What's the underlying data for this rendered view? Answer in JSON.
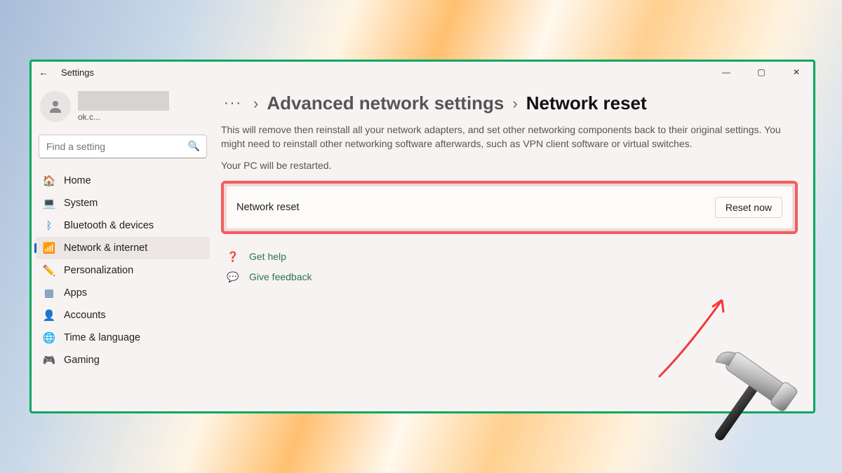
{
  "titlebar": {
    "app_name": "Settings",
    "back_glyph": "←",
    "min": "—",
    "max": "▢",
    "close": "✕"
  },
  "profile": {
    "email": "ok.c..."
  },
  "search": {
    "placeholder": "Find a setting"
  },
  "sidebar": {
    "items": [
      {
        "icon": "🏠",
        "label": "Home",
        "color": "#c97b3c"
      },
      {
        "icon": "💻",
        "label": "System",
        "color": "#1e88e5"
      },
      {
        "icon": "ᛒ",
        "label": "Bluetooth & devices",
        "color": "#1e88e5"
      },
      {
        "icon": "📶",
        "label": "Network & internet",
        "color": "#14a0e0",
        "active": true
      },
      {
        "icon": "✏️",
        "label": "Personalization",
        "color": "#b97a3a"
      },
      {
        "icon": "▦",
        "label": "Apps",
        "color": "#4d7aa8"
      },
      {
        "icon": "👤",
        "label": "Accounts",
        "color": "#3aa86e"
      },
      {
        "icon": "🌐",
        "label": "Time & language",
        "color": "#3a9fd6"
      },
      {
        "icon": "🎮",
        "label": "Gaming",
        "color": "#c24aa0"
      }
    ]
  },
  "breadcrumb": {
    "more": "···",
    "parent": "Advanced network settings",
    "sep": "›",
    "current": "Network reset"
  },
  "main": {
    "description": "This will remove then reinstall all your network adapters, and set other networking components back to their original settings. You might need to reinstall other networking software afterwards, such as VPN client software or virtual switches.",
    "restart_note": "Your PC will be restarted.",
    "card_label": "Network reset",
    "reset_button": "Reset now",
    "get_help": "Get help",
    "give_feedback": "Give feedback"
  },
  "annotation": {
    "border_color": "#00a860",
    "highlight_color": "#f05e5f"
  }
}
